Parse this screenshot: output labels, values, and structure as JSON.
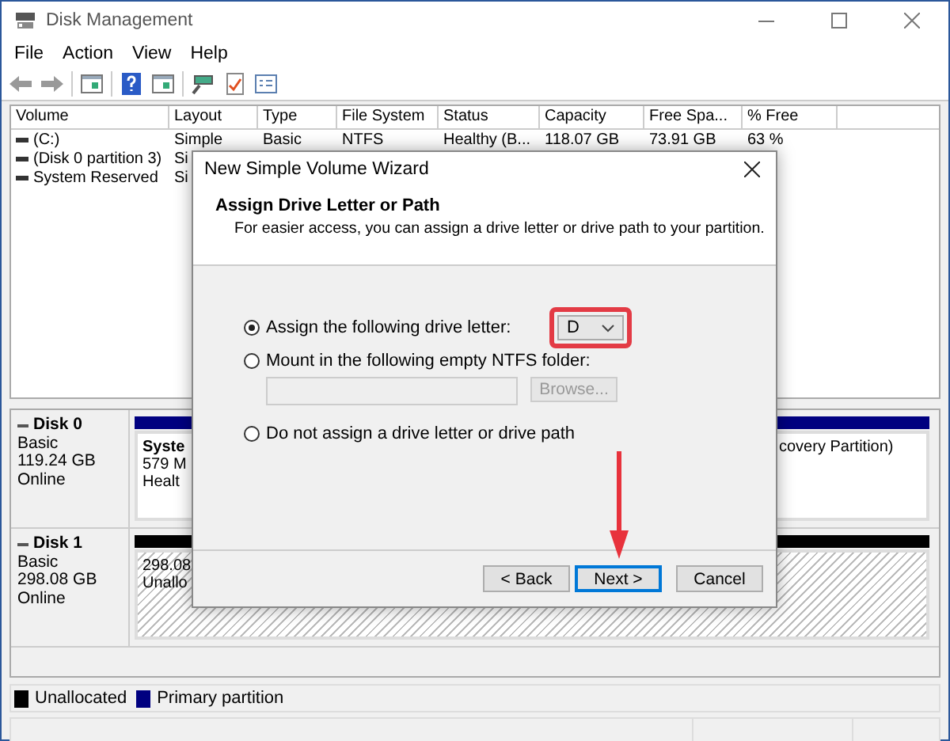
{
  "window": {
    "title": "Disk Management"
  },
  "menu": [
    "File",
    "Action",
    "View",
    "Help"
  ],
  "volume_table": {
    "columns": [
      "Volume",
      "Layout",
      "Type",
      "File System",
      "Status",
      "Capacity",
      "Free Spa...",
      "% Free"
    ],
    "rows": [
      [
        "(C:)",
        "Simple",
        "Basic",
        "NTFS",
        "Healthy (B...",
        "118.07 GB",
        "73.91 GB",
        "63 %"
      ],
      [
        "(Disk 0 partition 3)",
        "Si"
      ],
      [
        "System Reserved",
        "Si"
      ]
    ]
  },
  "disks": [
    {
      "name": "Disk 0",
      "type": "Basic",
      "size": "119.24 GB",
      "status": "Online",
      "partitions": [
        {
          "kind": "primary",
          "lines": [
            "Syste",
            "579 M",
            "Healt"
          ]
        },
        {
          "kind": "primary",
          "lines": [
            "covery Partition)"
          ]
        }
      ]
    },
    {
      "name": "Disk 1",
      "type": "Basic",
      "size": "298.08 GB",
      "status": "Online",
      "partitions": [
        {
          "kind": "unallocated",
          "lines": [
            "298.08",
            "Unallo"
          ]
        }
      ]
    }
  ],
  "legend": [
    {
      "label": "Unallocated",
      "color": "#000000"
    },
    {
      "label": "Primary partition",
      "color": "#000080"
    }
  ],
  "dialog": {
    "title": "New Simple Volume Wizard",
    "heading": "Assign Drive Letter or Path",
    "subtitle": "For easier access, you can assign a drive letter or drive path to your partition.",
    "options": [
      {
        "kind": "letter",
        "label": "Assign the following drive letter:",
        "selected": true,
        "value": "D"
      },
      {
        "kind": "folder",
        "label": "Mount in the following empty NTFS folder:",
        "selected": false,
        "button": "Browse..."
      },
      {
        "kind": "none",
        "label": "Do not assign a drive letter or drive path",
        "selected": false
      }
    ],
    "buttons": [
      {
        "label": "< Back",
        "default": false
      },
      {
        "label": "Next >",
        "default": true
      },
      {
        "label": "Cancel",
        "default": false
      }
    ]
  }
}
